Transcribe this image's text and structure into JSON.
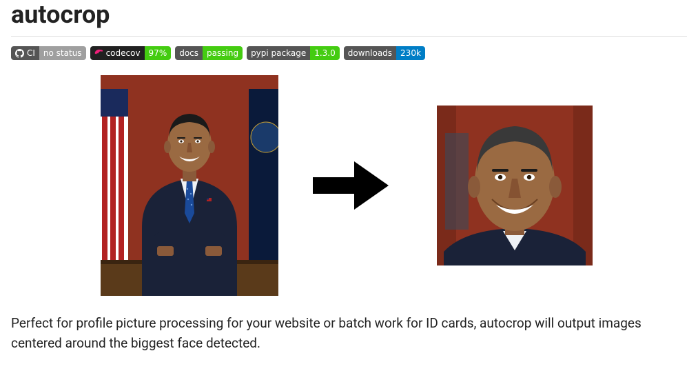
{
  "title": "autocrop",
  "badges": {
    "ci": {
      "label": "CI",
      "value": "no status",
      "left_bg": "#555",
      "right_bg": "#9f9f9f"
    },
    "codecov": {
      "label": "codecov",
      "value": "97%",
      "left_bg": "#212121",
      "right_bg": "#4c1"
    },
    "docs": {
      "label": "docs",
      "value": "passing",
      "left_bg": "#555",
      "right_bg": "#4c1"
    },
    "pypi": {
      "label": "pypi package",
      "value": "1.3.0",
      "left_bg": "#555",
      "right_bg": "#4c1"
    },
    "downloads": {
      "label": "downloads",
      "value": "230k",
      "left_bg": "#555",
      "right_bg": "#007ec6"
    }
  },
  "images": {
    "left_alt": "Original portrait photograph",
    "right_alt": "Cropped face output"
  },
  "description": "Perfect for profile picture processing for your website or batch work for ID cards, autocrop will output images centered around the biggest face detected."
}
